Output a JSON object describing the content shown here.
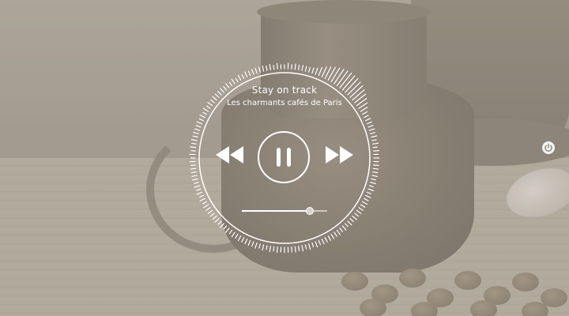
{
  "player": {
    "track_title": "Stay on track",
    "track_artist": "Les charmants cafés de Paris",
    "progress": 0.8
  },
  "icons": {
    "rewind": "rewind-icon",
    "pause": "pause-icon",
    "forward": "fast-forward-icon",
    "power": "power-icon"
  },
  "colors": {
    "accent": "#ffffff",
    "overlay": "#c8c2b7"
  }
}
